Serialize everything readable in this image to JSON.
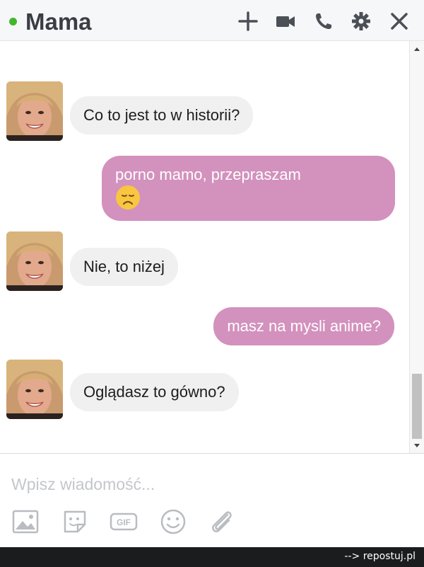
{
  "header": {
    "title": "Mama",
    "status": "online",
    "icons": [
      "add-icon",
      "video-call-icon",
      "phone-icon",
      "settings-icon",
      "close-icon"
    ],
    "accent_color": "#42b72a"
  },
  "messages": [
    {
      "direction": "incoming",
      "text": "Co to jest to w historii?"
    },
    {
      "direction": "outgoing",
      "text": "porno mamo, przepraszam",
      "emoji": "disappointed-face-emoji"
    },
    {
      "direction": "incoming",
      "text": "Nie, to niżej"
    },
    {
      "direction": "outgoing",
      "text": "masz na mysli anime?"
    },
    {
      "direction": "incoming",
      "text": "Oglądasz to gówno?"
    }
  ],
  "colors": {
    "incoming_bubble": "#f1f0f0",
    "outgoing_bubble": "#d391bd"
  },
  "composer": {
    "placeholder": "Wpisz wiadomość...",
    "tools": [
      "image-icon",
      "sticker-icon",
      "gif-icon",
      "emoji-icon",
      "attachment-icon"
    ],
    "gif_label": "GIF"
  },
  "watermark": "--> repostuj.pl"
}
